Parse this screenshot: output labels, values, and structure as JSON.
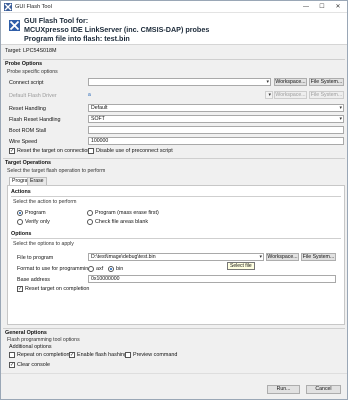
{
  "window": {
    "title": "GUI Flash Tool",
    "controls": {
      "minimize": "—",
      "maximize": "☐",
      "close": "✕"
    }
  },
  "banner": {
    "line1": "GUI Flash Tool for:",
    "line2": "MCUXpresso IDE LinkServer (inc. CMSIS-DAP) probes",
    "line3": "Program file into flash: test.bin"
  },
  "target": "Target: LPC54S018M",
  "probe_options": {
    "title": "Probe Options",
    "desc": "Probe specific options",
    "connect_script": {
      "label": "Connect script",
      "value": ""
    },
    "default_flash_driver": {
      "label": "Default Flash Driver",
      "value": ""
    },
    "reset_handling": {
      "label": "Reset Handling",
      "value": "Default"
    },
    "flash_reset_handling": {
      "label": "Flash Reset Handling",
      "value": "SOFT"
    },
    "boot_rom_stall": {
      "label": "Boot ROM Stall",
      "value": ""
    },
    "wire_speed": {
      "label": "Wire Speed",
      "value": "100000"
    },
    "reset_on_connection": "Reset the target on connection",
    "disable_preconnect": "Disable use of preconnect script",
    "workspace_label": "Workspace...",
    "file_system_label": "File System..."
  },
  "target_operations": {
    "title": "Target Operations",
    "desc": "Select the target flash operation to perform",
    "tabs": [
      "Program",
      "Erase"
    ],
    "actions": {
      "title": "Actions",
      "desc": "Select the action to perform",
      "program": "Program",
      "program_mass_erase": "Program (mass erase first)",
      "verify_only": "Verify only",
      "check_blank": "Check file areas blank"
    },
    "options": {
      "title": "Options",
      "desc": "Select the options to apply",
      "file_label": "File to program",
      "file_value": "D:\\test\\image\\debug\\test.bin",
      "tooltip": "Select file",
      "format_label": "Format to use for programming",
      "format_axf": "axf",
      "format_bin": "bin",
      "base_address_label": "Base address",
      "base_address_value": "0x10000000",
      "reset_on_completion": "Reset target on completion"
    }
  },
  "general_options": {
    "title": "General Options",
    "desc": "Flash programming tool options",
    "additional_label": "Additional options",
    "repeat_on_completion": "Repeat on completion",
    "enable_flash_hashing": "Enable flash hashing",
    "preview_command": "Preview command",
    "clear_console": "Clear console"
  },
  "footer": {
    "run_label": "Run...",
    "cancel_label": "Cancel"
  }
}
